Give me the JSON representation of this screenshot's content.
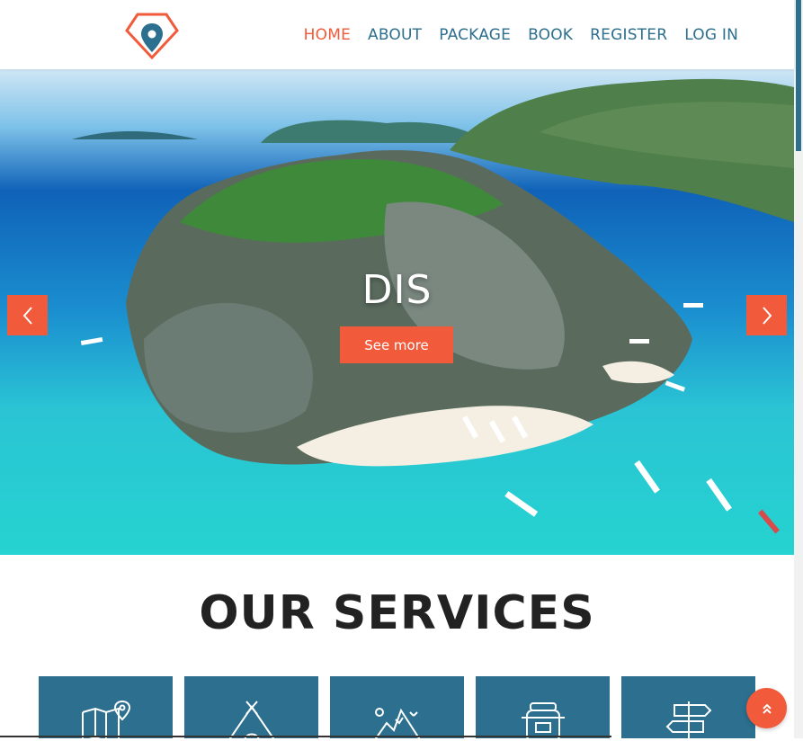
{
  "brand": {
    "accent": "#f15a3a",
    "primary": "#2c6f8e",
    "logo_icon": "map-pin-logo-icon"
  },
  "nav": {
    "items": [
      {
        "label": "HOME",
        "active": true
      },
      {
        "label": "ABOUT",
        "active": false
      },
      {
        "label": "PACKAGE",
        "active": false
      },
      {
        "label": "BOOK",
        "active": false
      },
      {
        "label": "REGISTER",
        "active": false
      },
      {
        "label": "LOG IN",
        "active": false
      }
    ]
  },
  "hero": {
    "title": "DIS",
    "button_label": "See more",
    "prev_icon": "chevron-left-icon",
    "next_icon": "chevron-right-icon"
  },
  "services": {
    "title": "OUR SERVICES",
    "tiles": [
      {
        "icon": "map-icon"
      },
      {
        "icon": "tent-icon"
      },
      {
        "icon": "mountain-icon"
      },
      {
        "icon": "backpack-icon"
      },
      {
        "icon": "signpost-icon"
      }
    ]
  },
  "scroll_top_icon": "double-chevron-up-icon"
}
